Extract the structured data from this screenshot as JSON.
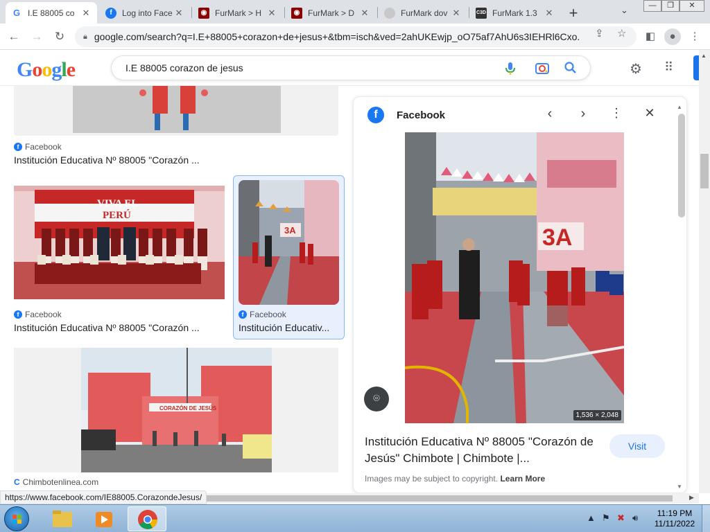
{
  "browser": {
    "tabs": [
      {
        "title": "I.E 88005 co",
        "icon": "google-g-icon"
      },
      {
        "title": "Log into Face",
        "icon": "facebook-icon"
      },
      {
        "title": "FurMark > H",
        "icon": "furmark-icon"
      },
      {
        "title": "FurMark > D",
        "icon": "furmark-icon"
      },
      {
        "title": "FurMark dov",
        "icon": "loading-icon"
      },
      {
        "title": "FurMark 1.3",
        "icon": "c3d-icon"
      }
    ],
    "tab_close": "✕",
    "new_tab": "+",
    "url": "google.com/search?q=I.E+88005+corazon+de+jesus+&tbm=isch&ved=2ahUKEwjp_oO75af7AhU6s3IEHRl6Cxo...",
    "window_controls": {
      "minimize": "—",
      "maximize": "❐",
      "close": "✕"
    }
  },
  "google": {
    "logo_letters": [
      "G",
      "o",
      "o",
      "g",
      "l",
      "e"
    ],
    "query": "I.E 88005 corazon de jesus"
  },
  "results": [
    {
      "source": "Facebook",
      "title": "Institución Educativa Nº 88005 \"Corazón ..."
    },
    {
      "source": "Facebook",
      "title": "Institución Educativa Nº 88005 \"Corazón ..."
    },
    {
      "source": "Facebook",
      "title": "Institución Educativ..."
    },
    {
      "source": "Chimbotenlinea.com",
      "title": ""
    }
  ],
  "thumb_text": {
    "viva": "VIVA EL",
    "peru": "PERÚ",
    "sign_3a": "3A",
    "school_sign": "CORAZÓN DE JESÚS"
  },
  "preview": {
    "source": "Facebook",
    "image_dims": "1,536 × 2,048",
    "title": "Institución Educativa Nº 88005 \"Corazón de Jesús\" Chimbote | Chimbote |...",
    "visit_label": "Visit",
    "copyright_text": "Images may be subject to copyright.",
    "learn_more": "Learn More"
  },
  "status_url": "https://www.facebook.com/IE88005.CorazondeJesus/",
  "taskbar": {
    "time": "11:19 PM",
    "date": "11/11/2022"
  },
  "colors": {
    "google_blue": "#4285f4",
    "google_red": "#ea4335",
    "google_yellow": "#fbbc05",
    "google_green": "#34a853",
    "facebook_blue": "#1877f2",
    "link_blue": "#1a73e8"
  }
}
